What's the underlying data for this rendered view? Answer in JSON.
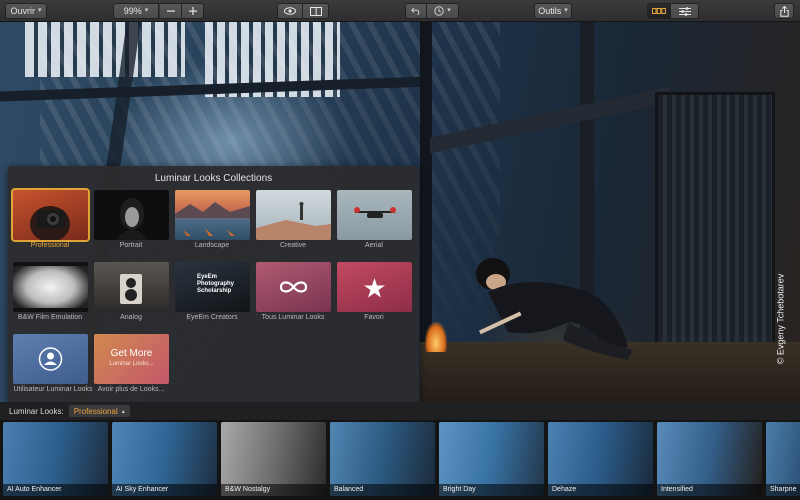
{
  "toolbar": {
    "open_label": "Ouvrir",
    "zoom_value": "99%",
    "tools_label": "Outils"
  },
  "panel": {
    "title": "Luminar Looks Collections",
    "tiles": [
      {
        "label": "Professional",
        "selected": true
      },
      {
        "label": "Portrait"
      },
      {
        "label": "Landscape"
      },
      {
        "label": "Creative"
      },
      {
        "label": "Aerial"
      },
      {
        "label": "B&W Film Emulation"
      },
      {
        "label": "Analog"
      },
      {
        "label": "EyeEm Creators",
        "overlay_lines": [
          "EyeEm",
          "Photography",
          "Scholarship"
        ]
      },
      {
        "label": "Tous Luminar Looks"
      },
      {
        "label": "Favori"
      },
      {
        "label": "Utilisateur Luminar Looks"
      },
      {
        "label": "Avoir plus de Looks...",
        "overlay_title": "Get More",
        "overlay_sub": "Luminar Looks..."
      }
    ]
  },
  "photo": {
    "credit": "© Evgeny Tchebotarev"
  },
  "looks_bar": {
    "label": "Luminar Looks:",
    "selected": "Professional"
  },
  "filmstrip": [
    {
      "name": "AI Auto Enhancer"
    },
    {
      "name": "AI Sky Enhancer"
    },
    {
      "name": "B&W Nostalgy"
    },
    {
      "name": "Balanced"
    },
    {
      "name": "Bright Day"
    },
    {
      "name": "Dehaze"
    },
    {
      "name": "Intensified"
    },
    {
      "name": "Sharpne"
    }
  ],
  "colors": {
    "accent": "#e7a53a",
    "toolbar_bg": "#333335",
    "panel_bg": "#2c2c2e"
  }
}
